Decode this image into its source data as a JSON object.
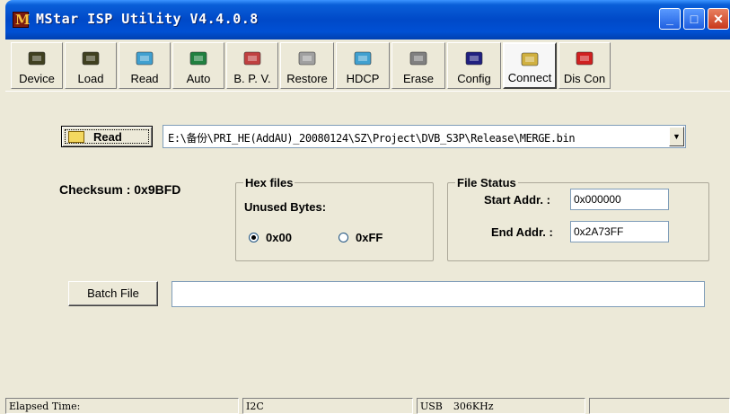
{
  "window": {
    "title": "MStar ISP Utility V4.4.0.8",
    "controls": [
      "minimize",
      "maximize",
      "close"
    ]
  },
  "toolbar": {
    "items": [
      {
        "label": "Device",
        "icon": "device-icon",
        "color": "#404020"
      },
      {
        "label": "Load",
        "icon": "load-icon",
        "color": "#404020"
      },
      {
        "label": "Read",
        "icon": "read-icon",
        "color": "#40a0d0"
      },
      {
        "label": "Auto",
        "icon": "auto-icon",
        "color": "#208040"
      },
      {
        "label": "B. P. V.",
        "icon": "bpv-icon",
        "color": "#c04040"
      },
      {
        "label": "Restore",
        "icon": "restore-icon",
        "color": "#a0a0a0"
      },
      {
        "label": "HDCP",
        "icon": "hdcp-icon",
        "color": "#40a0d0"
      },
      {
        "label": "Erase",
        "icon": "erase-icon",
        "color": "#808080"
      },
      {
        "label": "Config",
        "icon": "config-icon",
        "color": "#202080"
      },
      {
        "label": "Connect",
        "icon": "connect-icon",
        "color": "#d0b040",
        "active": true
      },
      {
        "label": "Dis Con",
        "icon": "disconnect-icon",
        "color": "#d02020"
      }
    ]
  },
  "main": {
    "read_button": "Read",
    "file_path": "E:\\备份\\PRI_HE(AddAU)_20080124\\SZ\\Project\\DVB_S3P\\Release\\MERGE.bin",
    "checksum": "Checksum : 0x9BFD",
    "hex_files": {
      "title": "Hex files",
      "unused_bytes_label": "Unused Bytes:",
      "options": [
        "0x00",
        "0xFF"
      ],
      "selected": "0x00"
    },
    "file_status": {
      "title": "File Status",
      "start_label": "Start Addr. :",
      "start_value": "0x000000",
      "end_label": "End Addr. :",
      "end_value": "0x2A73FF"
    },
    "batch_button": "Batch File",
    "batch_value": ""
  },
  "status": {
    "elapsed": "Elapsed Time:",
    "bus": "I2C",
    "usb": "USB",
    "speed": "306KHz",
    "extra": ""
  }
}
